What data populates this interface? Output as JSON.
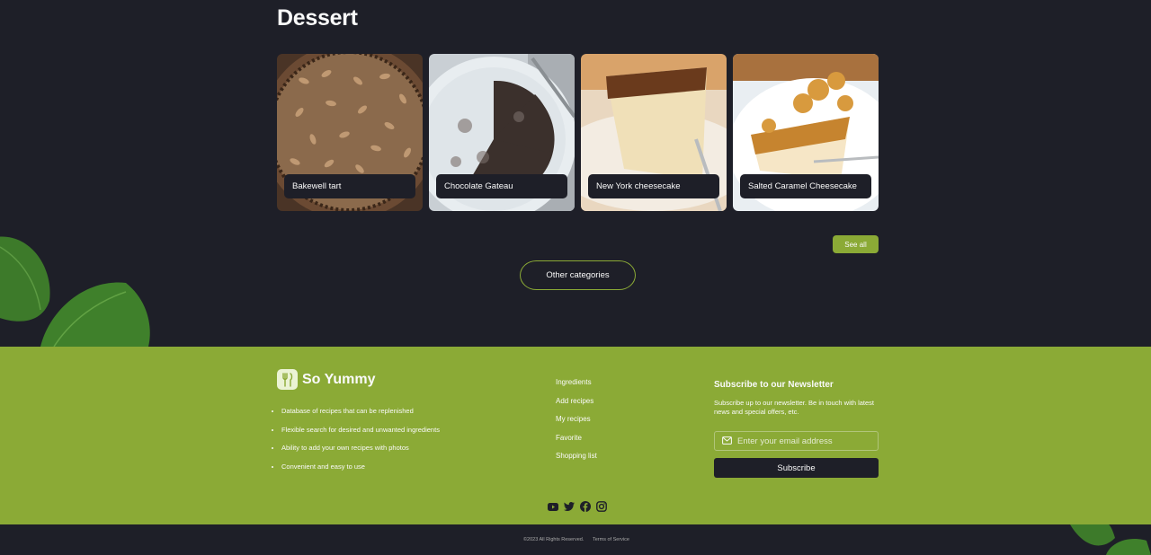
{
  "section": {
    "title": "Dessert"
  },
  "recipes": [
    {
      "title": "Bakewell tart"
    },
    {
      "title": "Chocolate Gateau"
    },
    {
      "title": "New York cheesecake"
    },
    {
      "title": "Salted Caramel Cheesecake"
    }
  ],
  "actions": {
    "see_all": "See all",
    "other_categories": "Other categories"
  },
  "footer": {
    "logo_text": "So Yummy",
    "features": [
      "Database of recipes that can be replenished",
      "Flexible search for desired and unwanted ingredients",
      "Ability to add your own recipes with photos",
      "Convenient and easy to use"
    ],
    "nav": [
      "Ingredients",
      "Add recipes",
      "My recipes",
      "Favorite",
      "Shopping list"
    ],
    "newsletter": {
      "title": "Subscribe to our Newsletter",
      "description": "Subscribe up to our newsletter. Be in touch with latest news and special offers, etc.",
      "email_placeholder": "Enter your email address",
      "button": "Subscribe"
    },
    "social_icons": [
      "youtube-icon",
      "twitter-icon",
      "facebook-icon",
      "instagram-icon"
    ]
  },
  "bottom": {
    "copyright": "©2023 All Rights Reserved.",
    "terms": "Terms of Service"
  },
  "colors": {
    "accent": "#8baa36",
    "background": "#1e1f28",
    "text": "#fafafa"
  }
}
